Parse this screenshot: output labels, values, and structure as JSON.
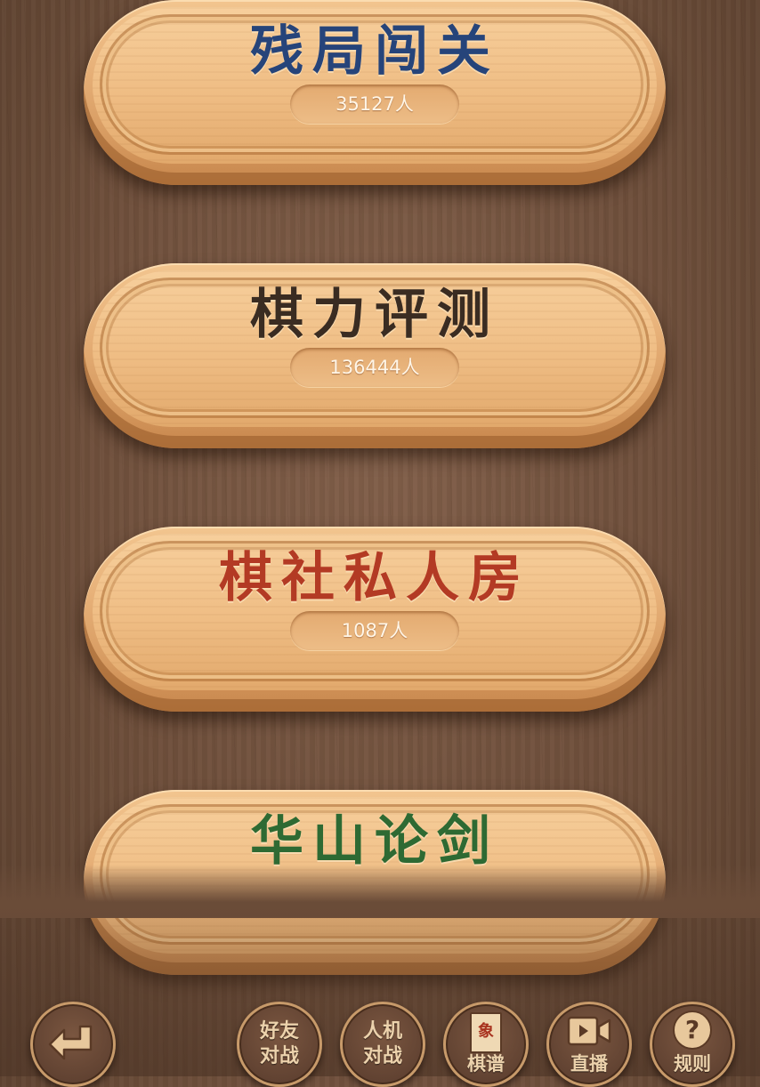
{
  "menu": [
    {
      "title": "残局闯关",
      "count": "35127人",
      "color": "#26447a"
    },
    {
      "title": "棋力评测",
      "count": "136444人",
      "color": "#3a2c22"
    },
    {
      "title": "棋社私人房",
      "count": "1087人",
      "color": "#b33a24"
    },
    {
      "title": "华山论剑",
      "count": "",
      "color": "#2e6a33"
    }
  ],
  "toolbar": {
    "back_icon": "return-arrow-icon",
    "friend_battle": {
      "line1": "好友",
      "line2": "对战"
    },
    "ai_battle": {
      "line1": "人机",
      "line2": "对战"
    },
    "records": {
      "label": "棋谱",
      "icon": "chess-book-icon",
      "glyph": "象"
    },
    "live": {
      "label": "直播",
      "icon": "video-camera-icon"
    },
    "rules": {
      "label": "规则",
      "icon": "question-icon",
      "glyph": "?"
    }
  },
  "colors": {
    "background": "#6e4f3b",
    "plank": "#efbd84",
    "toolbar_text": "#ecd2ac"
  }
}
